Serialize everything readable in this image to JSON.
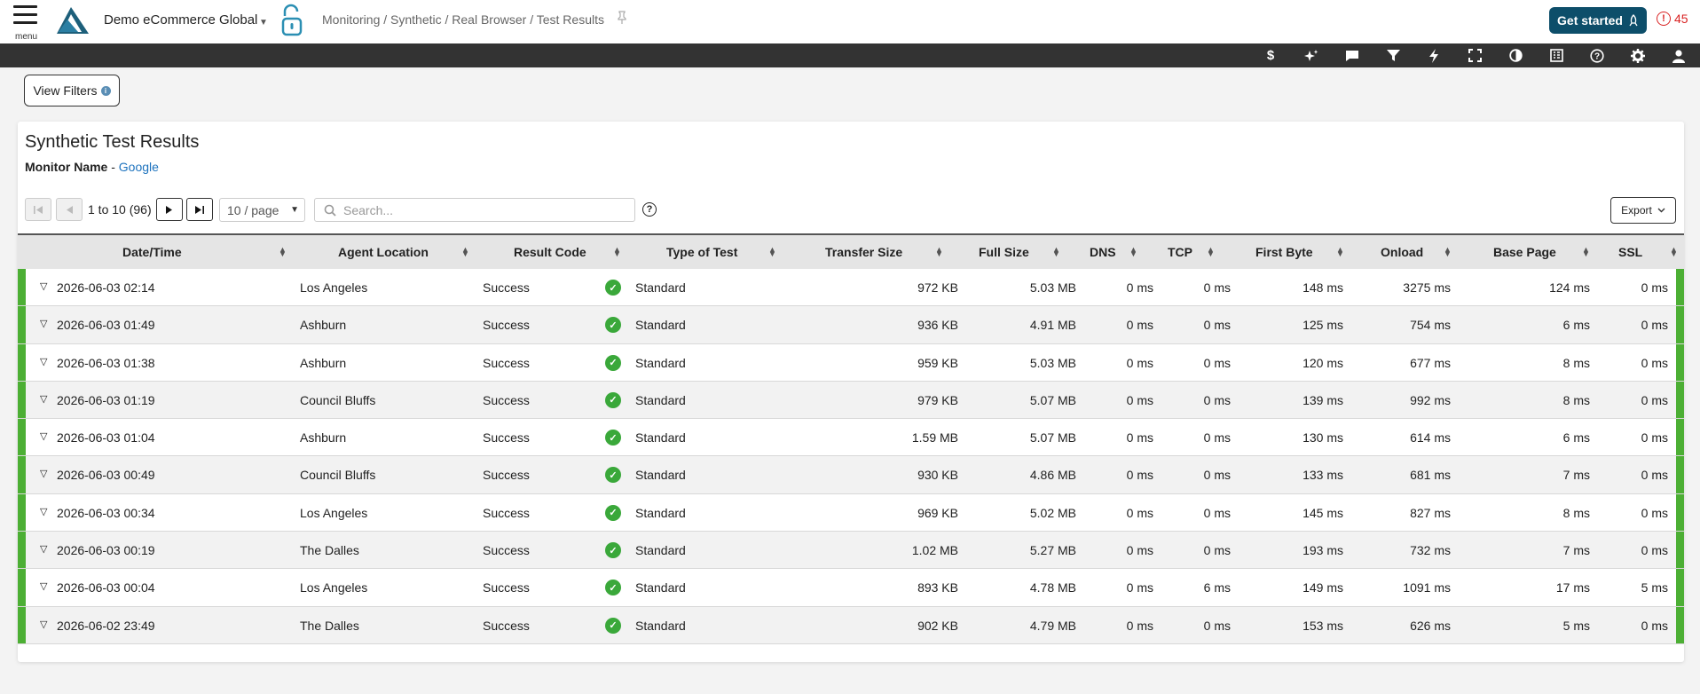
{
  "header": {
    "menu_label": "menu",
    "account": "Demo eCommerce Global",
    "breadcrumb": "Monitoring / Synthetic / Real Browser / Test Results",
    "get_started": "Get started",
    "alert_count": "45",
    "brand_color": "#0d4e6a"
  },
  "toolbar": {
    "icons": [
      "dollar-icon",
      "sparkle-icon",
      "chat-icon",
      "filter-icon",
      "bolt-icon",
      "fullscreen-icon",
      "contrast-icon",
      "report-icon",
      "help-icon",
      "gear-icon",
      "user-icon"
    ]
  },
  "filters": {
    "label": "View Filters"
  },
  "panel": {
    "title": "Synthetic Test Results",
    "monitor_key": "Monitor Name",
    "monitor_value": "Google"
  },
  "pager": {
    "range": "1 to 10 (96)",
    "page_size": "10 / page",
    "search_placeholder": "Search...",
    "export_label": "Export"
  },
  "columns": [
    "Date/Time",
    "Agent Location",
    "Result Code",
    "Type of Test",
    "Transfer Size",
    "Full Size",
    "DNS",
    "TCP",
    "First Byte",
    "Onload",
    "Base Page",
    "SSL"
  ],
  "rows": [
    {
      "dt": "2026-06-03 02:14",
      "loc": "Los Angeles",
      "result": "Success",
      "type": "Standard",
      "transfer": "972 KB",
      "full": "5.03 MB",
      "dns": "0 ms",
      "tcp": "0 ms",
      "fb": "148 ms",
      "onload": "3275 ms",
      "base": "124 ms",
      "ssl": "0 ms"
    },
    {
      "dt": "2026-06-03 01:49",
      "loc": "Ashburn",
      "result": "Success",
      "type": "Standard",
      "transfer": "936 KB",
      "full": "4.91 MB",
      "dns": "0 ms",
      "tcp": "0 ms",
      "fb": "125 ms",
      "onload": "754 ms",
      "base": "6 ms",
      "ssl": "0 ms"
    },
    {
      "dt": "2026-06-03 01:38",
      "loc": "Ashburn",
      "result": "Success",
      "type": "Standard",
      "transfer": "959 KB",
      "full": "5.03 MB",
      "dns": "0 ms",
      "tcp": "0 ms",
      "fb": "120 ms",
      "onload": "677 ms",
      "base": "8 ms",
      "ssl": "0 ms"
    },
    {
      "dt": "2026-06-03 01:19",
      "loc": "Council Bluffs",
      "result": "Success",
      "type": "Standard",
      "transfer": "979 KB",
      "full": "5.07 MB",
      "dns": "0 ms",
      "tcp": "0 ms",
      "fb": "139 ms",
      "onload": "992 ms",
      "base": "8 ms",
      "ssl": "0 ms"
    },
    {
      "dt": "2026-06-03 01:04",
      "loc": "Ashburn",
      "result": "Success",
      "type": "Standard",
      "transfer": "1.59 MB",
      "full": "5.07 MB",
      "dns": "0 ms",
      "tcp": "0 ms",
      "fb": "130 ms",
      "onload": "614 ms",
      "base": "6 ms",
      "ssl": "0 ms"
    },
    {
      "dt": "2026-06-03 00:49",
      "loc": "Council Bluffs",
      "result": "Success",
      "type": "Standard",
      "transfer": "930 KB",
      "full": "4.86 MB",
      "dns": "0 ms",
      "tcp": "0 ms",
      "fb": "133 ms",
      "onload": "681 ms",
      "base": "7 ms",
      "ssl": "0 ms"
    },
    {
      "dt": "2026-06-03 00:34",
      "loc": "Los Angeles",
      "result": "Success",
      "type": "Standard",
      "transfer": "969 KB",
      "full": "5.02 MB",
      "dns": "0 ms",
      "tcp": "0 ms",
      "fb": "145 ms",
      "onload": "827 ms",
      "base": "8 ms",
      "ssl": "0 ms"
    },
    {
      "dt": "2026-06-03 00:19",
      "loc": "The Dalles",
      "result": "Success",
      "type": "Standard",
      "transfer": "1.02 MB",
      "full": "5.27 MB",
      "dns": "0 ms",
      "tcp": "0 ms",
      "fb": "193 ms",
      "onload": "732 ms",
      "base": "7 ms",
      "ssl": "0 ms"
    },
    {
      "dt": "2026-06-03 00:04",
      "loc": "Los Angeles",
      "result": "Success",
      "type": "Standard",
      "transfer": "893 KB",
      "full": "4.78 MB",
      "dns": "0 ms",
      "tcp": "6 ms",
      "fb": "149 ms",
      "onload": "1091 ms",
      "base": "17 ms",
      "ssl": "5 ms"
    },
    {
      "dt": "2026-06-02 23:49",
      "loc": "The Dalles",
      "result": "Success",
      "type": "Standard",
      "transfer": "902 KB",
      "full": "4.79 MB",
      "dns": "0 ms",
      "tcp": "0 ms",
      "fb": "153 ms",
      "onload": "626 ms",
      "base": "5 ms",
      "ssl": "0 ms"
    }
  ],
  "colors": {
    "status_success": "#4caf34",
    "link": "#1e73be",
    "alert": "#d92323"
  }
}
